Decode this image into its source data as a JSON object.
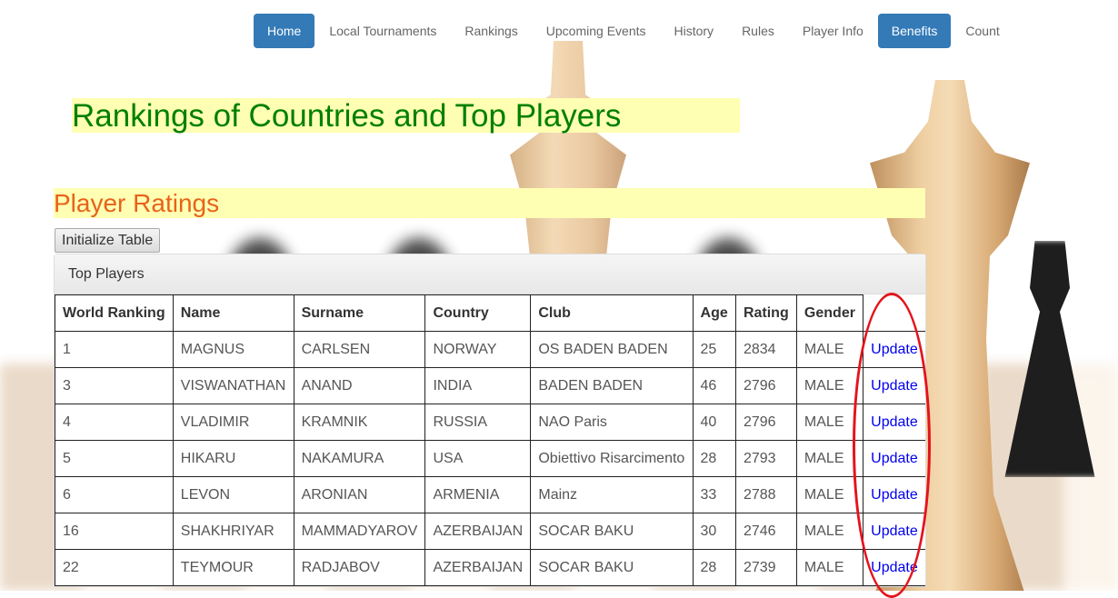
{
  "nav": {
    "items": [
      {
        "label": "Home",
        "active": true
      },
      {
        "label": "Local Tournaments",
        "active": false
      },
      {
        "label": "Rankings",
        "active": false
      },
      {
        "label": "Upcoming Events",
        "active": false
      },
      {
        "label": "History",
        "active": false
      },
      {
        "label": "Rules",
        "active": false
      },
      {
        "label": "Player Info",
        "active": false
      },
      {
        "label": "Benefits",
        "active": true
      },
      {
        "label": "Count",
        "active": false
      }
    ]
  },
  "page_title": "Rankings of Countries and Top Players",
  "section_title": "Player Ratings",
  "init_button": "Initialize Table",
  "panel_title": "Top Players",
  "table": {
    "headers": [
      "World Ranking",
      "Name",
      "Surname",
      "Country",
      "Club",
      "Age",
      "Rating",
      "Gender",
      ""
    ],
    "action_label": "Update",
    "rows": [
      [
        "1",
        "MAGNUS",
        "CARLSEN",
        "NORWAY",
        "OS BADEN BADEN",
        "25",
        "2834",
        "MALE"
      ],
      [
        "3",
        "VISWANATHAN",
        "ANAND",
        "INDIA",
        "BADEN BADEN",
        "46",
        "2796",
        "MALE"
      ],
      [
        "4",
        "VLADIMIR",
        "KRAMNIK",
        "RUSSIA",
        "NAO Paris",
        "40",
        "2796",
        "MALE"
      ],
      [
        "5",
        "HIKARU",
        "NAKAMURA",
        "USA",
        "Obiettivo Risarcimento",
        "28",
        "2793",
        "MALE"
      ],
      [
        "6",
        "LEVON",
        "ARONIAN",
        "ARMENIA",
        "Mainz",
        "33",
        "2788",
        "MALE"
      ],
      [
        "16",
        "SHAKHRIYAR",
        "MAMMADYAROV",
        "AZERBAIJAN",
        "SOCAR BAKU",
        "30",
        "2746",
        "MALE"
      ],
      [
        "22",
        "TEYMOUR",
        "RADJABOV",
        "AZERBAIJAN",
        "SOCAR BAKU",
        "28",
        "2739",
        "MALE"
      ]
    ]
  },
  "colors": {
    "nav_active": "#337ab7",
    "title_green": "#008000",
    "title_orange": "#e8621a",
    "highlight_yellow": "#ffffb3",
    "annotation_red": "#e3141c"
  }
}
